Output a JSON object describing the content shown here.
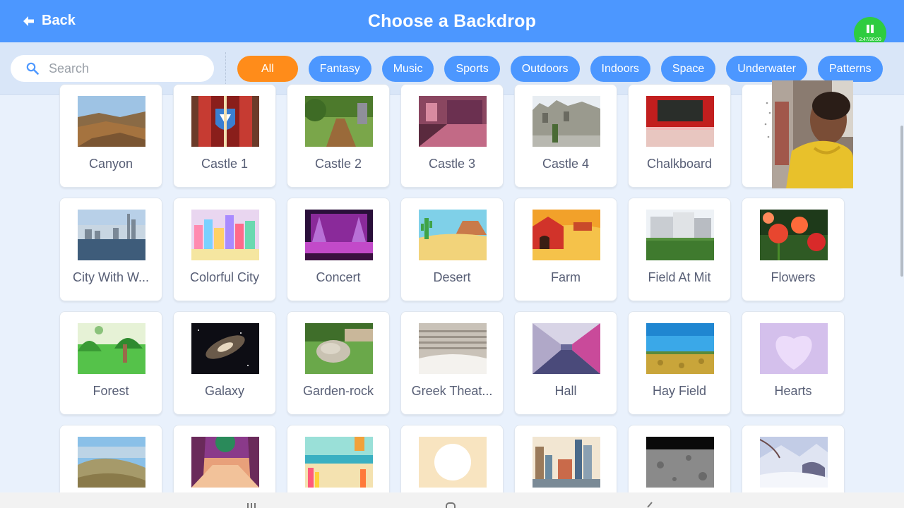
{
  "header": {
    "back_label": "Back",
    "title": "Choose a Backdrop",
    "recorder_time": "2:47/30:00"
  },
  "search": {
    "placeholder": "Search"
  },
  "categories": [
    "All",
    "Fantasy",
    "Music",
    "Sports",
    "Outdoors",
    "Indoors",
    "Space",
    "Underwater",
    "Patterns"
  ],
  "selected_category": "All",
  "backdrops": [
    {
      "label": "Canyon",
      "thumb": "canyon"
    },
    {
      "label": "Castle 1",
      "thumb": "castle1"
    },
    {
      "label": "Castle 2",
      "thumb": "castle2"
    },
    {
      "label": "Castle 3",
      "thumb": "castle3"
    },
    {
      "label": "Castle 4",
      "thumb": "castle4"
    },
    {
      "label": "Chalkboard",
      "thumb": "chalkboard"
    },
    {
      "label": "",
      "thumb": "dots"
    },
    {
      "label": "City With W...",
      "thumb": "city"
    },
    {
      "label": "Colorful City",
      "thumb": "colorful"
    },
    {
      "label": "Concert",
      "thumb": "concert"
    },
    {
      "label": "Desert",
      "thumb": "desert"
    },
    {
      "label": "Farm",
      "thumb": "farm"
    },
    {
      "label": "Field At Mit",
      "thumb": "field"
    },
    {
      "label": "Flowers",
      "thumb": "flowers"
    },
    {
      "label": "Forest",
      "thumb": "forest"
    },
    {
      "label": "Galaxy",
      "thumb": "galaxy"
    },
    {
      "label": "Garden-rock",
      "thumb": "garden"
    },
    {
      "label": "Greek Theat...",
      "thumb": "greek"
    },
    {
      "label": "Hall",
      "thumb": "hall"
    },
    {
      "label": "Hay Field",
      "thumb": "hay"
    },
    {
      "label": "Hearts",
      "thumb": "hearts"
    },
    {
      "label": "",
      "thumb": "hill"
    },
    {
      "label": "",
      "thumb": "jungle"
    },
    {
      "label": "",
      "thumb": "beach"
    },
    {
      "label": "",
      "thumb": "circle"
    },
    {
      "label": "",
      "thumb": "nyc"
    },
    {
      "label": "",
      "thumb": "moon"
    },
    {
      "label": "",
      "thumb": "winter"
    }
  ],
  "colors": {
    "header": "#4c97ff",
    "chip": "#4c97ff",
    "chip_active": "#ff8c1a",
    "background": "#e9f1fc",
    "recorder": "#2ecc40"
  },
  "icons": [
    "back-arrow-icon",
    "search-icon",
    "pause-icon"
  ]
}
